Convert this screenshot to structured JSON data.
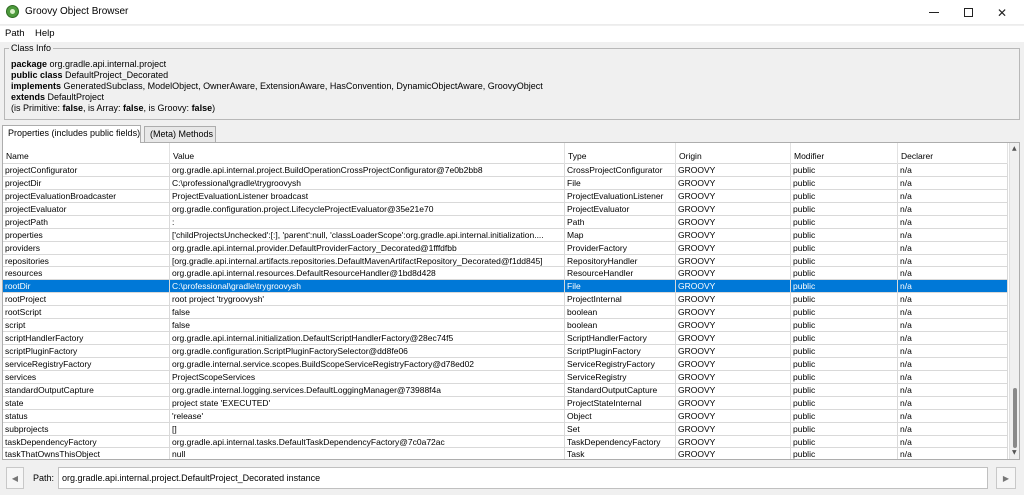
{
  "window": {
    "title": "Groovy Object Browser"
  },
  "menu": {
    "items": [
      "Path",
      "Help"
    ]
  },
  "class_info": {
    "legend": "Class Info",
    "package_kw": "package",
    "package_val": "org.gradle.api.internal.project",
    "class_kw": "public class",
    "class_val": "DefaultProject_Decorated",
    "implements_kw": "implements",
    "implements_val": "GeneratedSubclass, ModelObject, OwnerAware, ExtensionAware, HasConvention, DynamicObjectAware, GroovyObject",
    "extends_kw": "extends",
    "extends_val": "DefaultProject",
    "flags": {
      "primitive_label": "(is Primitive: ",
      "primitive_val": "false",
      "array_label": ", is Array: ",
      "array_val": "false",
      "groovy_label": ", is Groovy: ",
      "groovy_val": "false",
      "close": ")"
    }
  },
  "tabs": [
    "Properties (includes public fields)",
    "(Meta) Methods"
  ],
  "table": {
    "columns": [
      "Name",
      "Value",
      "Type",
      "Origin",
      "Modifier",
      "Declarer"
    ],
    "selected_index": 9,
    "rows": [
      [
        "projectConfigurator",
        "org.gradle.api.internal.project.BuildOperationCrossProjectConfigurator@7e0b2bb8",
        "CrossProjectConfigurator",
        "GROOVY",
        "public",
        "n/a"
      ],
      [
        "projectDir",
        "C:\\professional\\gradle\\trygroovysh",
        "File",
        "GROOVY",
        "public",
        "n/a"
      ],
      [
        "projectEvaluationBroadcaster",
        "ProjectEvaluationListener broadcast",
        "ProjectEvaluationListener",
        "GROOVY",
        "public",
        "n/a"
      ],
      [
        "projectEvaluator",
        "org.gradle.configuration.project.LifecycleProjectEvaluator@35e21e70",
        "ProjectEvaluator",
        "GROOVY",
        "public",
        "n/a"
      ],
      [
        "projectPath",
        ":",
        "Path",
        "GROOVY",
        "public",
        "n/a"
      ],
      [
        "properties",
        "['childProjectsUnchecked':[:], 'parent':null, 'classLoaderScope':org.gradle.api.internal.initialization....",
        "Map",
        "GROOVY",
        "public",
        "n/a"
      ],
      [
        "providers",
        "org.gradle.api.internal.provider.DefaultProviderFactory_Decorated@1fffdfbb",
        "ProviderFactory",
        "GROOVY",
        "public",
        "n/a"
      ],
      [
        "repositories",
        "[org.gradle.api.internal.artifacts.repositories.DefaultMavenArtifactRepository_Decorated@f1dd845]",
        "RepositoryHandler",
        "GROOVY",
        "public",
        "n/a"
      ],
      [
        "resources",
        "org.gradle.api.internal.resources.DefaultResourceHandler@1bd8d428",
        "ResourceHandler",
        "GROOVY",
        "public",
        "n/a"
      ],
      [
        "rootDir",
        "C:\\professional\\gradle\\trygroovysh",
        "File",
        "GROOVY",
        "public",
        "n/a"
      ],
      [
        "rootProject",
        "root project 'trygroovysh'",
        "ProjectInternal",
        "GROOVY",
        "public",
        "n/a"
      ],
      [
        "rootScript",
        "false",
        "boolean",
        "GROOVY",
        "public",
        "n/a"
      ],
      [
        "script",
        "false",
        "boolean",
        "GROOVY",
        "public",
        "n/a"
      ],
      [
        "scriptHandlerFactory",
        "org.gradle.api.internal.initialization.DefaultScriptHandlerFactory@28ec74f5",
        "ScriptHandlerFactory",
        "GROOVY",
        "public",
        "n/a"
      ],
      [
        "scriptPluginFactory",
        "org.gradle.configuration.ScriptPluginFactorySelector@dd8fe06",
        "ScriptPluginFactory",
        "GROOVY",
        "public",
        "n/a"
      ],
      [
        "serviceRegistryFactory",
        "org.gradle.internal.service.scopes.BuildScopeServiceRegistryFactory@d78ed02",
        "ServiceRegistryFactory",
        "GROOVY",
        "public",
        "n/a"
      ],
      [
        "services",
        "ProjectScopeServices",
        "ServiceRegistry",
        "GROOVY",
        "public",
        "n/a"
      ],
      [
        "standardOutputCapture",
        "org.gradle.internal.logging.services.DefaultLoggingManager@73988f4a",
        "StandardOutputCapture",
        "GROOVY",
        "public",
        "n/a"
      ],
      [
        "state",
        "project state 'EXECUTED'",
        "ProjectStateInternal",
        "GROOVY",
        "public",
        "n/a"
      ],
      [
        "status",
        "'release'",
        "Object",
        "GROOVY",
        "public",
        "n/a"
      ],
      [
        "subprojects",
        "[]",
        "Set",
        "GROOVY",
        "public",
        "n/a"
      ],
      [
        "taskDependencyFactory",
        "org.gradle.api.internal.tasks.DefaultTaskDependencyFactory@7c0a72ac",
        "TaskDependencyFactory",
        "GROOVY",
        "public",
        "n/a"
      ],
      [
        "taskThatOwnsThisObject",
        "null",
        "Task",
        "GROOVY",
        "public",
        "n/a"
      ]
    ]
  },
  "path": {
    "label": "Path:",
    "value": "org.gradle.api.internal.project.DefaultProject_Decorated instance"
  }
}
